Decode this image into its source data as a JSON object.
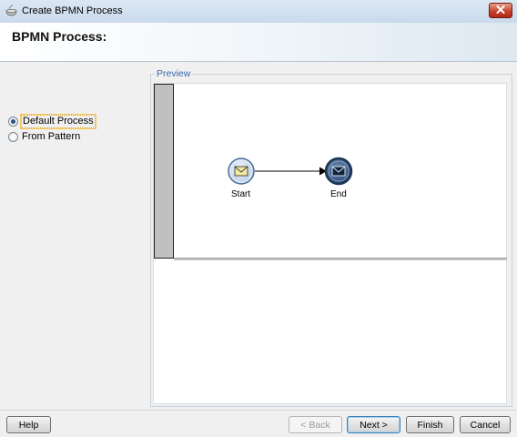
{
  "window": {
    "title": "Create BPMN Process",
    "icon": "bpmn-process-icon",
    "close_icon": "close-icon"
  },
  "header": {
    "title": "BPMN Process:"
  },
  "options": [
    {
      "label": "Default Process",
      "selected": true
    },
    {
      "label": "From Pattern",
      "selected": false
    }
  ],
  "preview": {
    "legend": "Preview",
    "start_label": "Start",
    "end_label": "End",
    "start_icon": "message-envelope-icon",
    "end_icon": "message-envelope-icon"
  },
  "buttons": {
    "help": "Help",
    "back": "< Back",
    "next": "Next >",
    "finish": "Finish",
    "cancel": "Cancel"
  },
  "colors": {
    "close_button": "#c7432e",
    "legend": "#3a68a8",
    "start_event": "#d8e6f3",
    "end_event": "#3d5f8a"
  }
}
